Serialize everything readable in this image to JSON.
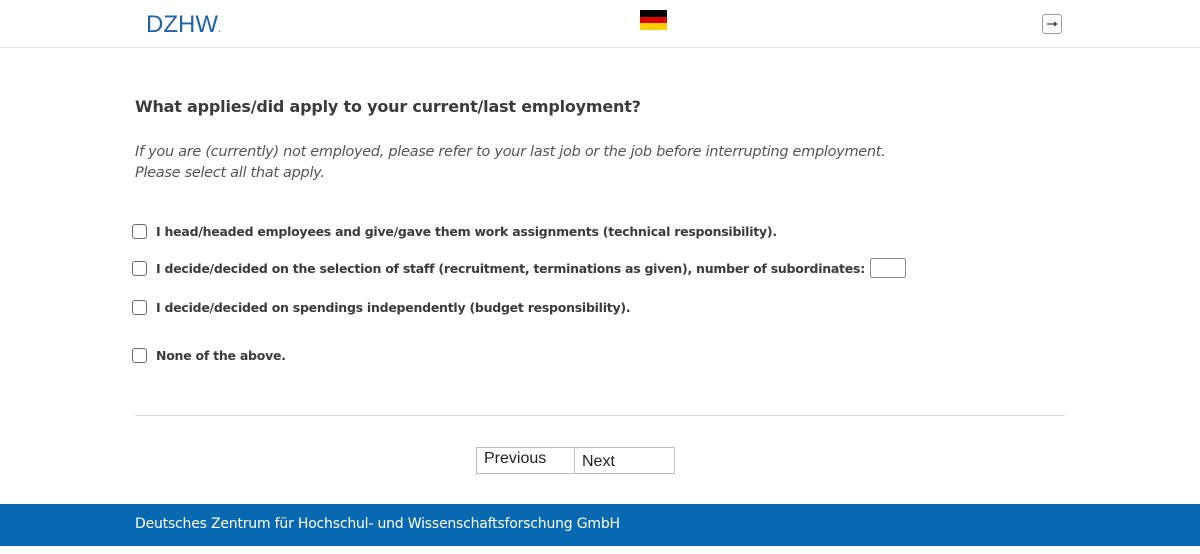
{
  "header": {
    "logo_text": "DZHW",
    "logo_dot": ".",
    "flag_colors": [
      "#000000",
      "#dd0000",
      "#ffce00"
    ],
    "flag_icon": "germany-flag-icon",
    "logout_icon": "exit-icon"
  },
  "question": {
    "title": "What applies/did apply to your current/last employment?",
    "instruction_line1": "If you are (currently) not employed, please refer to your last job or the job before interrupting employment.",
    "instruction_line2": "Please select all that apply."
  },
  "options": [
    {
      "label": "I head/headed employees and give/gave them work assignments (technical responsibility).",
      "checked": false
    },
    {
      "label": "I decide/decided on the selection of staff (recruitment, terminations as given), number of subordinates:",
      "checked": false,
      "input_value": ""
    },
    {
      "label": "I decide/decided on spendings independently (budget responsibility).",
      "checked": false
    },
    {
      "label": "None of the above.",
      "checked": false
    }
  ],
  "navigation": {
    "previous_label": "Previous",
    "next_label": "Next"
  },
  "footer": {
    "text": "Deutsches Zentrum für Hochschul- und Wissenschaftsforschung GmbH",
    "background": "#0869b0"
  }
}
